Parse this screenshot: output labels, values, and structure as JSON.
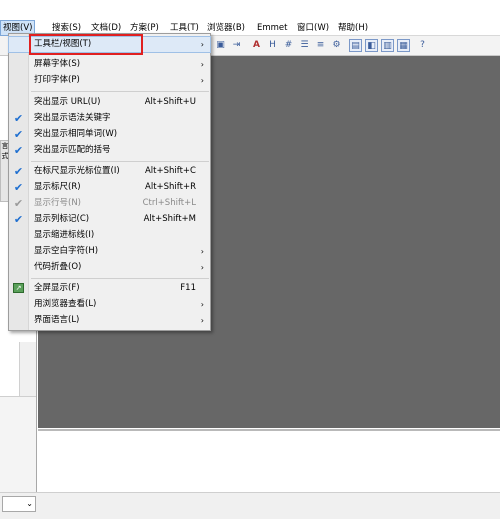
{
  "menubar": {
    "items": [
      "视图(V)",
      "搜索(S)",
      "文档(D)",
      "方案(P)",
      "工具(T)",
      "浏览器(B)",
      "Emmet",
      "窗口(W)",
      "帮助(H)"
    ]
  },
  "view_menu": {
    "items": [
      {
        "label": "工具栏/视图(T)",
        "shortcut": "",
        "submenu": "›"
      },
      {
        "label": "屏幕字体(S)",
        "shortcut": "",
        "submenu": "›"
      },
      {
        "label": "打印字体(P)",
        "shortcut": "",
        "submenu": "›"
      },
      {
        "label": "突出显示 URL(U)",
        "shortcut": "Alt+Shift+U",
        "submenu": ""
      },
      {
        "label": "突出显示语法关键字",
        "shortcut": "",
        "submenu": ""
      },
      {
        "label": "突出显示相同单词(W)",
        "shortcut": "",
        "submenu": ""
      },
      {
        "label": "突出显示匹配的括号",
        "shortcut": "",
        "submenu": ""
      },
      {
        "label": "在标尺显示光标位置(I)",
        "shortcut": "Alt+Shift+C",
        "submenu": ""
      },
      {
        "label": "显示标尺(R)",
        "shortcut": "Alt+Shift+R",
        "submenu": ""
      },
      {
        "label": "显示行号(N)",
        "shortcut": "Ctrl+Shift+L",
        "submenu": ""
      },
      {
        "label": "显示列标记(C)",
        "shortcut": "Alt+Shift+M",
        "submenu": ""
      },
      {
        "label": "显示缩进标线(I)",
        "shortcut": "",
        "submenu": ""
      },
      {
        "label": "显示空白字符(H)",
        "shortcut": "",
        "submenu": "›"
      },
      {
        "label": "代码折叠(O)",
        "shortcut": "",
        "submenu": "›"
      },
      {
        "label": "全屏显示(F)",
        "shortcut": "F11",
        "submenu": ""
      },
      {
        "label": "用浏览器查看(L)",
        "shortcut": "",
        "submenu": "›"
      },
      {
        "label": "界面语言(L)",
        "shortcut": "",
        "submenu": "›"
      }
    ]
  },
  "left_panel": {
    "tab_text": "言式",
    "scroll_down": "⌄",
    "combo_arrow": "⌄"
  },
  "colors": {
    "editor_bg": "#676767",
    "check": "#1f6fd0",
    "highlight_box": "#e02020"
  }
}
